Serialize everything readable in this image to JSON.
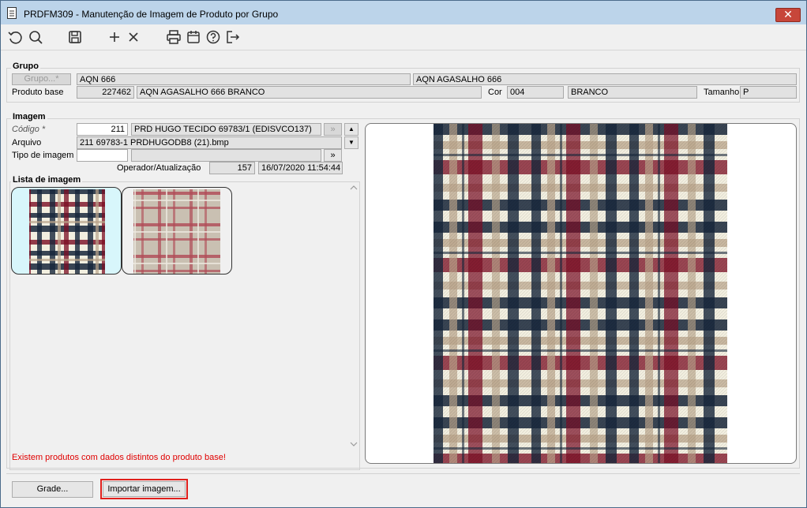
{
  "window": {
    "title": "PRDFM309 - Manutenção de Imagem de Produto por Grupo",
    "close_label": "✕"
  },
  "toolbar": {
    "icons": [
      "refresh-icon",
      "search-icon",
      "save-icon",
      "add-icon",
      "delete-icon",
      "print-icon",
      "calendar-icon",
      "help-icon",
      "exit-icon"
    ]
  },
  "grupo": {
    "legend": "Grupo",
    "grupo_button": "Grupo...*",
    "grupo_code": "AQN 666",
    "grupo_desc": "AQN AGASALHO 666",
    "produto_base_label": "Produto base",
    "produto_base_code": "227462",
    "produto_base_desc": "AQN AGASALHO 666 BRANCO",
    "cor_label": "Cor",
    "cor_code": "004",
    "cor_desc": "BRANCO",
    "tamanho_label": "Tamanho",
    "tamanho_value": "P"
  },
  "imagem": {
    "legend": "Imagem",
    "codigo_label": "Código *",
    "codigo_value": "211",
    "codigo_desc": "PRD HUGO TECIDO 69783/1 (EDISVCO137)",
    "arquivo_label": "Arquivo",
    "arquivo_value": "211 69783-1 PRDHUGODB8 (21).bmp",
    "tipo_label": "Tipo de imagem",
    "tipo_value": "",
    "tipo_desc": "",
    "operador_label": "Operador/Atualização",
    "operador_value": "157",
    "atualizacao_value": "16/07/2020 11:54:44",
    "more_label": "»",
    "up_label": "▲",
    "down_label": "▼"
  },
  "lista": {
    "legend": "Lista de imagem"
  },
  "warning": "Existem produtos com dados distintos do produto base!",
  "buttons": {
    "grade": "Grade...",
    "importar": "Importar imagem..."
  },
  "colors": {
    "accent_red": "#e0201c",
    "warning_red": "#e00000",
    "selected_thumb": "#d8f6fb",
    "plaid_maroon": "#7a0c23",
    "plaid_navy": "#17263b",
    "plaid_beige": "#b9a48a",
    "plaid_cream": "#f2efe0"
  }
}
